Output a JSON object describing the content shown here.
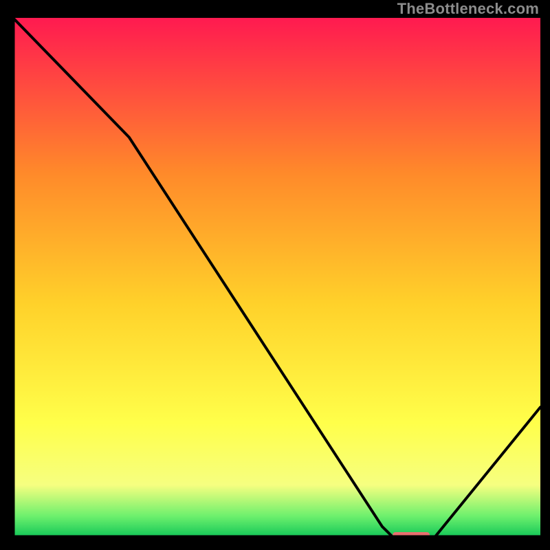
{
  "watermark": "TheBottleneck.com",
  "colors": {
    "top": "#ff1a50",
    "mid_upper": "#ff8a2a",
    "mid": "#ffd12a",
    "mid_yellow": "#ffff4a",
    "lower_yellow": "#f6ff80",
    "green_band": "#6df06d",
    "deep_green": "#12c758",
    "curve": "#000000",
    "marker": "#e87070",
    "border": "#000000"
  },
  "chart_data": {
    "type": "line",
    "title": "",
    "xlabel": "",
    "ylabel": "",
    "xlim": [
      0,
      100
    ],
    "ylim": [
      0,
      100
    ],
    "x": [
      0,
      22,
      70,
      72,
      80,
      100
    ],
    "values": [
      100,
      77,
      2,
      0,
      0,
      25
    ],
    "marker_segment": {
      "x0": 72,
      "x1": 79,
      "y": 0.4
    },
    "annotations": []
  }
}
